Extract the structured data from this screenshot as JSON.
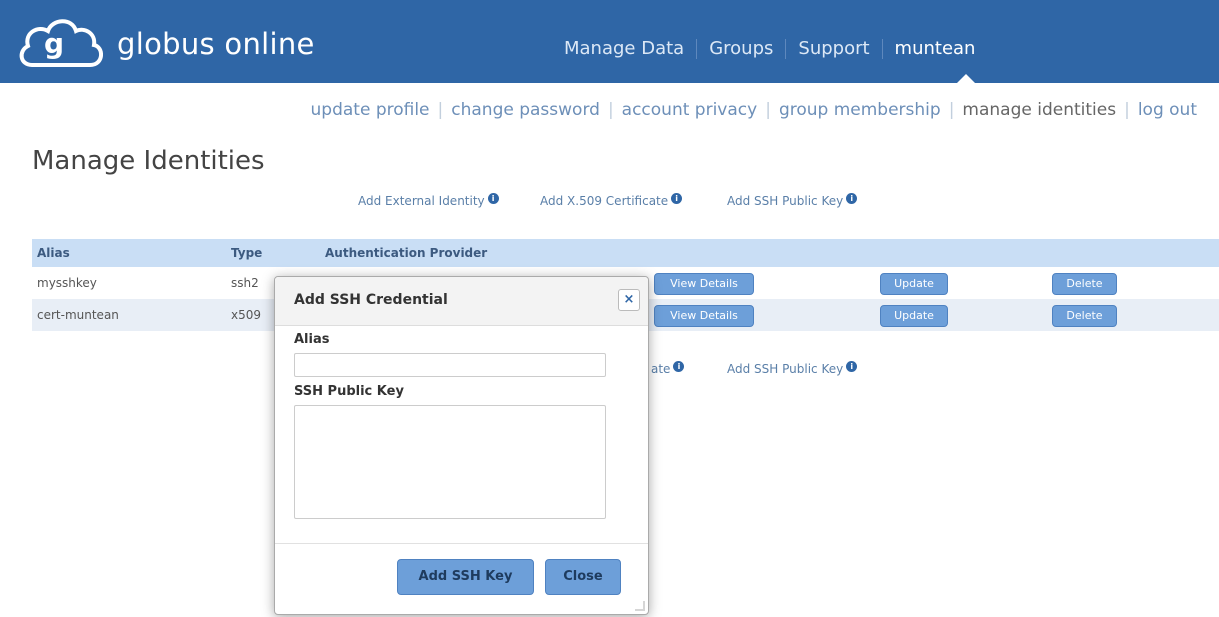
{
  "header": {
    "brand": "globus online",
    "nav": [
      "Manage Data",
      "Groups",
      "Support",
      "muntean"
    ],
    "brand_color": "#2f66a6"
  },
  "subnav": {
    "items": [
      "update profile",
      "change password",
      "account privacy",
      "group membership",
      "manage identities",
      "log out"
    ],
    "active": "manage identities"
  },
  "page": {
    "title": "Manage Identities"
  },
  "actions": {
    "external": "Add External Identity",
    "x509": "Add X.509 Certificate",
    "ssh": "Add SSH Public Key",
    "ssh_bottom": "Add SSH Public Key",
    "x509_bottom_partial": "ate"
  },
  "table": {
    "headers": [
      "Alias",
      "Type",
      "Authentication Provider"
    ],
    "rows": [
      {
        "alias": "mysshkey",
        "type": "ssh2",
        "details": "View Details",
        "update": "Update",
        "delete": "Delete"
      },
      {
        "alias": "cert-muntean",
        "type": "x509",
        "details": "View Details",
        "update": "Update",
        "delete": "Delete"
      }
    ]
  },
  "modal": {
    "title": "Add SSH Credential",
    "alias_label": "Alias",
    "alias_value": "",
    "key_label": "SSH Public Key",
    "key_value": "",
    "add_button": "Add SSH Key",
    "close_button": "Close",
    "close_icon": "×"
  }
}
